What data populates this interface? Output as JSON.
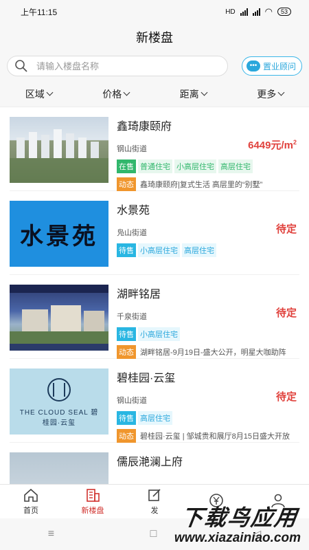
{
  "status": {
    "time": "上午11:15",
    "network": "HD",
    "battery": "53"
  },
  "header": {
    "title": "新楼盘"
  },
  "search": {
    "placeholder": "请输入楼盘名称",
    "advisor_label": "置业顾问"
  },
  "filters": [
    "区域",
    "价格",
    "距离",
    "更多"
  ],
  "listings": [
    {
      "name": "鑫琦康颐府",
      "street": "钢山街道",
      "price": "6449元/m",
      "price_unit_sup": "2",
      "sale_status": "在售",
      "types": [
        "普通住宅",
        "小高层住宅",
        "高层住宅"
      ],
      "news_tag": "动态",
      "news": "鑫琦康颐府|复式生活 高层里的“别墅”",
      "thumb_text": ""
    },
    {
      "name": "水景苑",
      "street": "凫山街道",
      "price": "待定",
      "price_unit_sup": "",
      "sale_status": "待售",
      "types": [
        "小高层住宅",
        "高层住宅"
      ],
      "news_tag": "",
      "news": "",
      "thumb_text": "水景苑"
    },
    {
      "name": "湖畔铭居",
      "street": "千泉街道",
      "price": "待定",
      "price_unit_sup": "",
      "sale_status": "待售",
      "types": [
        "小高层住宅"
      ],
      "news_tag": "动态",
      "news": "湖畔铭居-9月19日-盛大公开，明星大咖助阵",
      "thumb_text": ""
    },
    {
      "name": "碧桂园·云玺",
      "street": "钢山街道",
      "price": "待定",
      "price_unit_sup": "",
      "sale_status": "待售",
      "types": [
        "高层住宅"
      ],
      "news_tag": "动态",
      "news": "碧桂园·云玺 | 邹城贵和展厅8月15日盛大开放",
      "thumb_text": "THE CLOUD SEAL 碧桂园·云玺"
    },
    {
      "name": "儒辰滟澜上府",
      "street": "",
      "price": "",
      "price_unit_sup": "",
      "sale_status": "",
      "types": [],
      "news_tag": "",
      "news": "",
      "thumb_text": ""
    }
  ],
  "tabbar": [
    {
      "label": "首页",
      "icon": "home-icon"
    },
    {
      "label": "新楼盘",
      "icon": "building-icon",
      "active": true
    },
    {
      "label": "发",
      "icon": "edit-icon"
    },
    {
      "label": "",
      "icon": "yuan-icon"
    },
    {
      "label": "",
      "icon": "user-icon"
    }
  ],
  "watermark": {
    "line1": "下载鸟应用",
    "line2": "www.xiazainiao.com"
  },
  "colors": {
    "accent": "#d0312d",
    "blue": "#2aa7dc",
    "green": "#31b76c",
    "orange": "#f0962d"
  }
}
